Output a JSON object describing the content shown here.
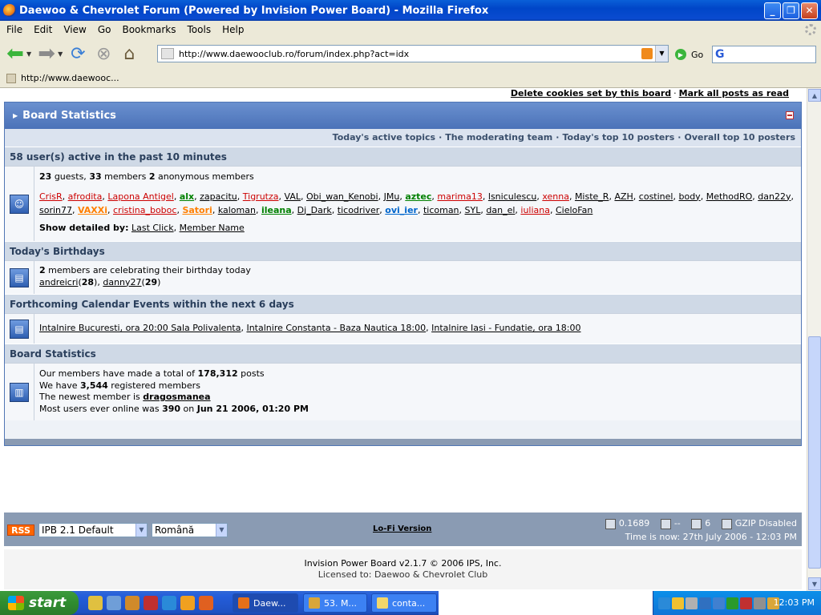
{
  "window": {
    "title": "Daewoo & Chevrolet Forum (Powered by Invision Power Board) - Mozilla Firefox",
    "minimize": "_",
    "maximize": "❐",
    "close": "✕"
  },
  "menu": [
    "File",
    "Edit",
    "View",
    "Go",
    "Bookmarks",
    "Tools",
    "Help"
  ],
  "nav": {
    "url": "http://www.daewooclub.ro/forum/index.php?act=idx",
    "go_label": "Go",
    "search_value": ""
  },
  "bookmarks": {
    "item": "http://www.daewooc..."
  },
  "forum": {
    "top_links": [
      "Delete cookies set by this board",
      "Mark all posts as read"
    ],
    "section_title": "Board Statistics",
    "sublinks": [
      "Today's active topics",
      "The moderating team",
      "Today's top 10 posters",
      "Overall top 10 posters"
    ],
    "active": {
      "header": "58 user(s) active in the past 10 minutes",
      "guests": "23",
      "guests_label": "guests,",
      "members": "33",
      "members_label": "members",
      "anon": "2",
      "anon_label": "anonymous members",
      "users": [
        {
          "name": "CrisR",
          "color": "red"
        },
        {
          "name": "afrodita",
          "color": "red"
        },
        {
          "name": "Lapona Antigel",
          "color": "red"
        },
        {
          "name": "alx",
          "color": "green"
        },
        {
          "name": "zapacitu",
          "color": "black"
        },
        {
          "name": "Tigrutza",
          "color": "red"
        },
        {
          "name": "VAL",
          "color": "black"
        },
        {
          "name": "Obi_wan_Kenobi",
          "color": "black"
        },
        {
          "name": "JMu",
          "color": "black"
        },
        {
          "name": "aztec",
          "color": "green"
        },
        {
          "name": "marima13",
          "color": "red"
        },
        {
          "name": "lsniculescu",
          "color": "black"
        },
        {
          "name": "xenna",
          "color": "red"
        },
        {
          "name": "Miste_R",
          "color": "black"
        },
        {
          "name": "AZH",
          "color": "black"
        },
        {
          "name": "costinel",
          "color": "black"
        },
        {
          "name": "body",
          "color": "black"
        },
        {
          "name": "MethodRO",
          "color": "black"
        },
        {
          "name": "dan22y",
          "color": "black"
        },
        {
          "name": "sorin77",
          "color": "black"
        },
        {
          "name": "VAXXi",
          "color": "orange"
        },
        {
          "name": "cristina_boboc",
          "color": "red"
        },
        {
          "name": "Satori",
          "color": "orange"
        },
        {
          "name": "kaloman",
          "color": "black"
        },
        {
          "name": "ileana",
          "color": "green"
        },
        {
          "name": "Dj_Dark",
          "color": "black"
        },
        {
          "name": "ticodriver",
          "color": "black"
        },
        {
          "name": "ovi_ier",
          "color": "blue"
        },
        {
          "name": "ticoman",
          "color": "black"
        },
        {
          "name": "SYL",
          "color": "black"
        },
        {
          "name": "dan_el",
          "color": "black"
        },
        {
          "name": "iuliana",
          "color": "red"
        },
        {
          "name": "CieloFan",
          "color": "black"
        }
      ],
      "detail_label": "Show detailed by:",
      "detail_links": [
        "Last Click",
        "Member Name"
      ]
    },
    "birthdays": {
      "header": "Today's Birthdays",
      "count": "2",
      "text": "members are celebrating their birthday today",
      "people": [
        {
          "name": "andreicri",
          "age": "28"
        },
        {
          "name": "danny27",
          "age": "29"
        }
      ]
    },
    "events": {
      "header": "Forthcoming Calendar Events within the next 6 days",
      "items": [
        "Intalnire Bucuresti, ora 20:00 Sala Polivalenta",
        "Intalnire Constanta - Baza Nautica 18:00",
        "Intalnire Iasi - Fundatie, ora 18:00"
      ]
    },
    "stats": {
      "header": "Board Statistics",
      "posts_prefix": "Our members have made a total of",
      "posts": "178,312",
      "posts_suffix": "posts",
      "members_prefix": "We have",
      "members": "3,544",
      "members_suffix": "registered members",
      "newest_prefix": "The newest member is",
      "newest": "dragosmanea",
      "record_prefix": "Most users ever online was",
      "record": "390",
      "record_on": "on",
      "record_date": "Jun 21 2006, 01:20 PM"
    },
    "footer": {
      "rss": "RSS",
      "skin": "IPB 2.1 Default",
      "language": "Română",
      "lofi": "Lo-Fi Version",
      "exec_time": "0.1689",
      "server_load": "--",
      "queries": "6",
      "gzip": "GZIP Disabled",
      "time": "Time is now: 27th July 2006 - 12:03 PM",
      "copyright": "Invision Power Board v2.1.7 © 2006  IPS, Inc.",
      "license": "Licensed to: Daewoo & Chevrolet Club"
    }
  },
  "taskbar": {
    "start": "start",
    "tasks": [
      "Daew...",
      "53. M...",
      "conta..."
    ],
    "clock": "12:03 PM"
  }
}
